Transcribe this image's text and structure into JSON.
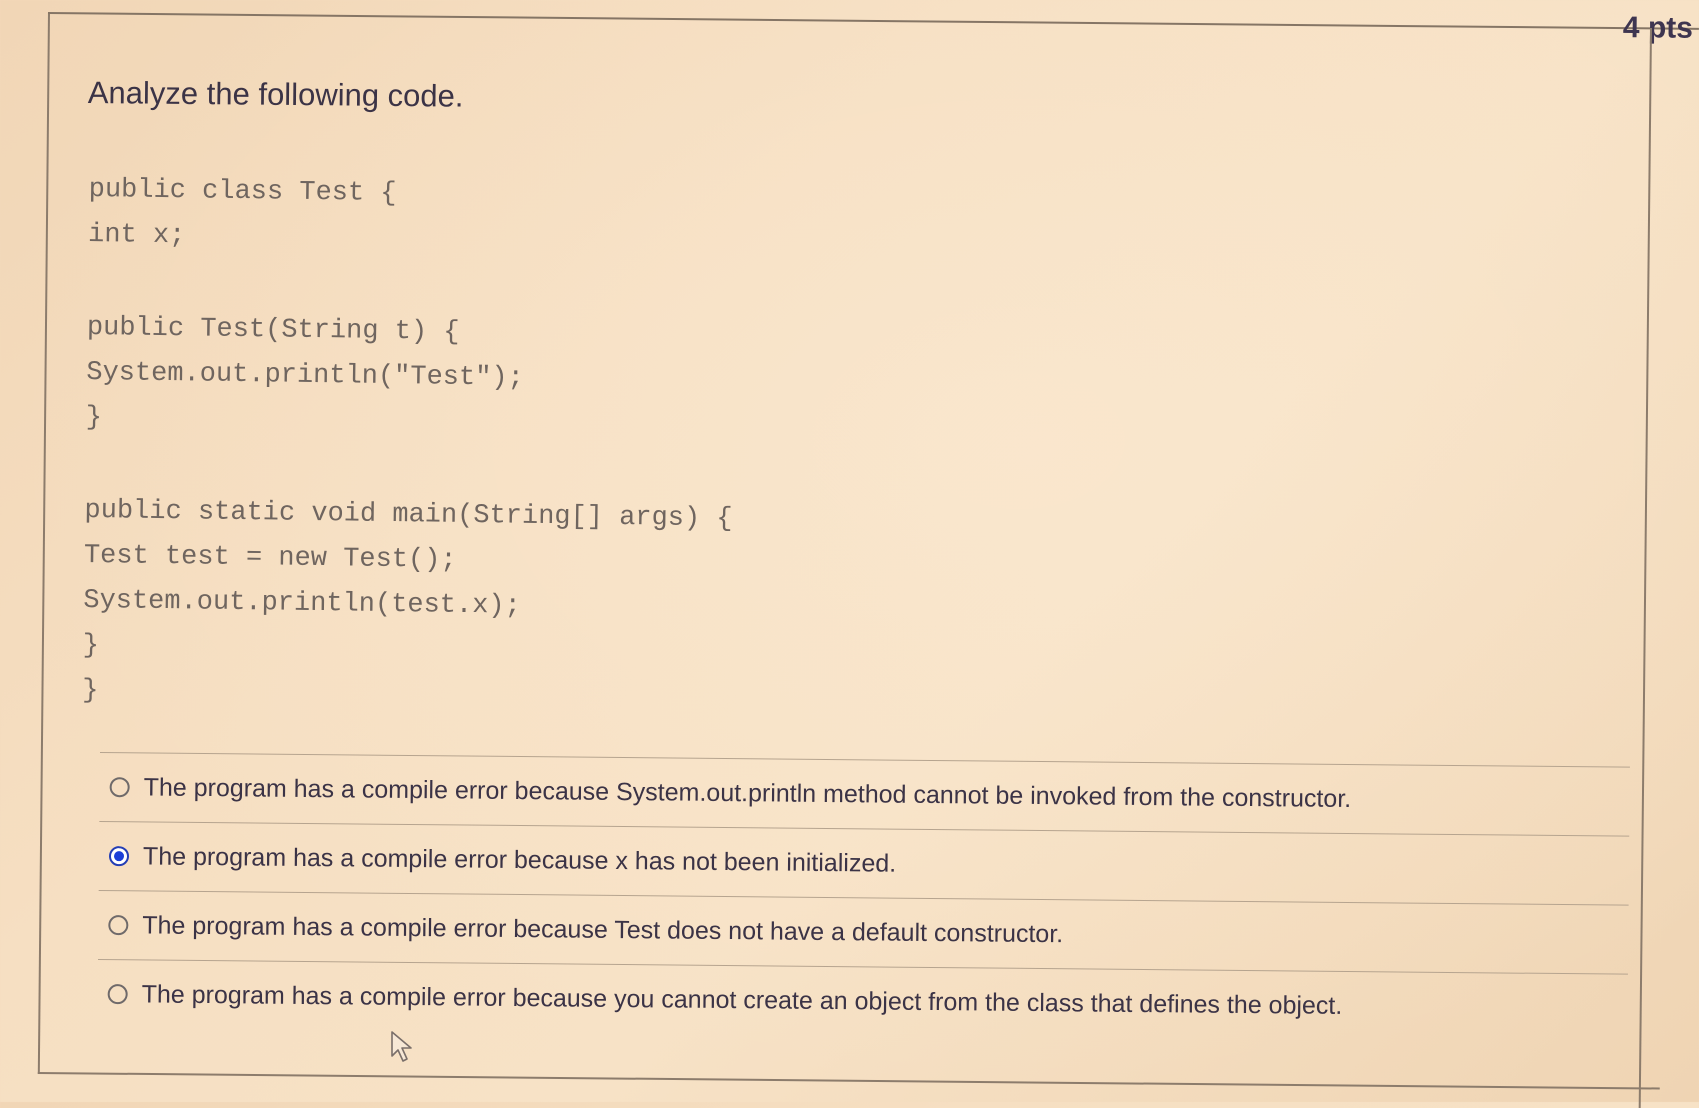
{
  "header": {
    "points": "4 pts"
  },
  "question": {
    "prompt": "Analyze the following code.",
    "code_lines": [
      "public class Test {",
      "int x;",
      "",
      "public Test(String t) {",
      "System.out.println(\"Test\");",
      "}",
      "",
      "public static void main(String[] args) {",
      "Test test = new Test();",
      "System.out.println(test.x);",
      "}",
      "}"
    ]
  },
  "answers": [
    {
      "label": "The program has a compile error because System.out.println method cannot be invoked from the constructor.",
      "selected": false
    },
    {
      "label": "The program has a compile error because x has not been initialized.",
      "selected": true
    },
    {
      "label": "The program has a compile error because Test does not have a default constructor.",
      "selected": false
    },
    {
      "label": "The program has a compile error because you cannot create an object from the class that defines the object.",
      "selected": false
    }
  ],
  "colors": {
    "selected_radio": "#1b3fd8",
    "text": "#3b3346",
    "code_text": "#6f655f",
    "background": "#f6dfc2"
  }
}
